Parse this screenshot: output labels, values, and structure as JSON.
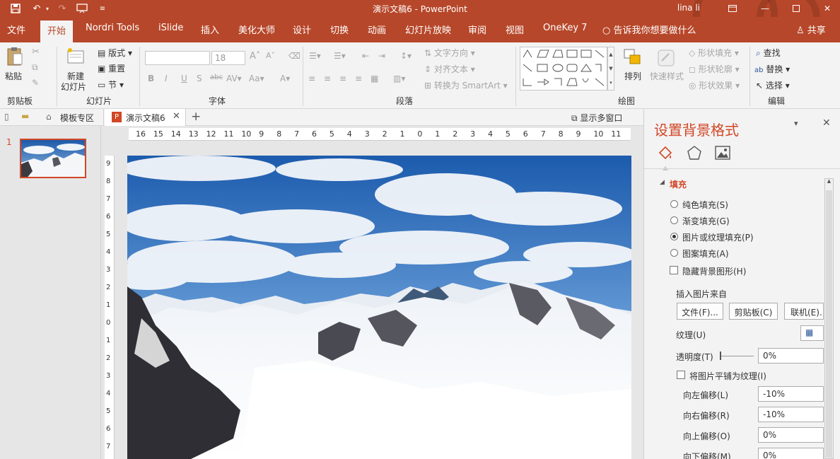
{
  "app": {
    "window_title": "演示文稿6  -  PowerPoint",
    "user_name": "lina li"
  },
  "menu": {
    "tabs": [
      "文件",
      "开始",
      "Nordri Tools",
      "iSlide",
      "插入",
      "美化大师",
      "设计",
      "切换",
      "动画",
      "幻灯片放映",
      "审阅",
      "视图",
      "OneKey 7"
    ],
    "tell_me": "告诉我你想要做什么",
    "share": "共享"
  },
  "ribbon": {
    "clipboard": {
      "paste": "粘贴",
      "group": "剪贴板"
    },
    "slides": {
      "new_slide_1": "新建",
      "new_slide_2": "幻灯片",
      "layout": "版式",
      "reset": "重置",
      "section": "节",
      "group": "幻灯片"
    },
    "font": {
      "size": "18",
      "group": "字体"
    },
    "paragraph": {
      "text_direction": "文字方向",
      "align_text": "对齐文本",
      "smartart": "转换为 SmartArt",
      "group": "段落"
    },
    "drawing": {
      "arrange": "排列",
      "quick_styles": "快速样式",
      "shape_fill": "形状填充",
      "shape_outline": "形状轮廓",
      "shape_effects": "形状效果",
      "group": "绘图"
    },
    "editing": {
      "find": "查找",
      "replace": "替换",
      "select": "选择",
      "group": "编辑"
    }
  },
  "doc_tabs": {
    "template": "模板专区",
    "current": "演示文稿6",
    "multi_window": "显示多窗口"
  },
  "thumbnails": {
    "slide_number": "1"
  },
  "ruler": {
    "h_ticks": [
      "16",
      "15",
      "14",
      "13",
      "12",
      "11",
      "10",
      "9",
      "8",
      "7",
      "6",
      "5",
      "4",
      "3",
      "2",
      "1",
      "0",
      "1",
      "2",
      "3",
      "4",
      "5",
      "6",
      "7",
      "8",
      "9",
      "10",
      "11"
    ],
    "v_ticks": [
      "9",
      "8",
      "7",
      "6",
      "5",
      "4",
      "3",
      "2",
      "1",
      "0",
      "1",
      "2",
      "3",
      "4",
      "5",
      "6",
      "7"
    ]
  },
  "format_pane": {
    "title": "设置背景格式",
    "section": "填充",
    "options": [
      "纯色填充(S)",
      "渐变填充(G)",
      "图片或纹理填充(P)",
      "图案填充(A)"
    ],
    "hide_background": "隐藏背景图形(H)",
    "insert_from": "插入图片来自",
    "file_btn": "文件(F)...",
    "clipboard_btn": "剪贴板(C)",
    "online_btn": "联机(E)...",
    "texture": "纹理(U)",
    "transparency": "透明度(T)",
    "transparency_value": "0%",
    "tile": "将图片平铺为纹理(I)",
    "offset_left": "向左偏移(L)",
    "offset_left_value": "-10%",
    "offset_right": "向右偏移(R)",
    "offset_right_value": "-10%",
    "offset_top": "向上偏移(O)",
    "offset_top_value": "0%",
    "offset_bottom": "向下偏移(M)",
    "offset_bottom_value": "0%"
  },
  "colors": {
    "accent": "#b7472a",
    "ribbon_bg": "#f3f3f3",
    "sky": "#2f6fb8"
  },
  "icons": [
    "save-icon",
    "undo-icon",
    "redo-icon",
    "start-from-beginning-icon",
    "customize-icon",
    "ribbon-display-icon",
    "minimize-icon",
    "restore-icon",
    "close-icon",
    "lightbulb-icon",
    "person-icon",
    "paste-icon",
    "cut-icon",
    "copy-icon",
    "format-painter-icon",
    "new-slide-icon",
    "arrange-icon",
    "quick-styles-icon",
    "find-icon",
    "replace-icon",
    "select-icon",
    "fill-icon",
    "effects-icon",
    "picture-icon",
    "texture-icon"
  ]
}
